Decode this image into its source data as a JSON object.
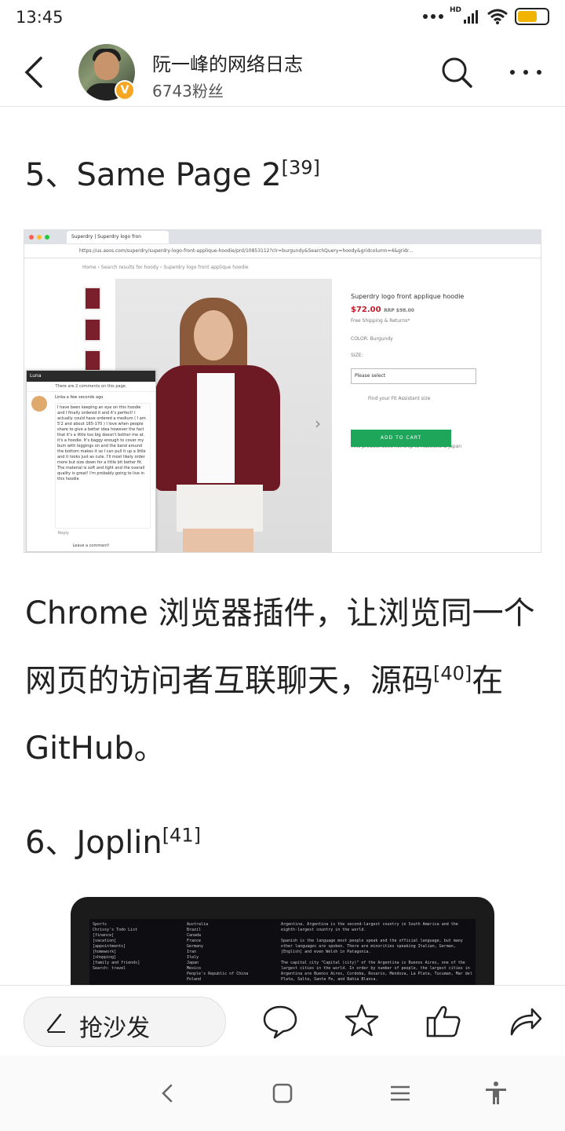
{
  "status": {
    "time": "13:45",
    "network": "HD"
  },
  "header": {
    "author": "阮一峰的网络日志",
    "fans": "6743粉丝",
    "verified_badge": "V"
  },
  "article": {
    "item5_prefix": "5、Same Page 2",
    "item5_ref": "[39]",
    "paragraph_a": "Chrome 浏览器插件，让浏览同一个网页的访问者互联聊天，源码",
    "paragraph_ref": "[40]",
    "paragraph_b": "在 GitHub。",
    "item6_prefix": "6、Joplin",
    "item6_ref": "[41]"
  },
  "screenshot1": {
    "tab_title": "Superdry | Superdry logo fron",
    "url": "https://us.asos.com/superdry/superdry-logo-front-applique-hoodie/prd/10853112?clr=burgundy&SearchQuery=hoody&gridcolumn=4&gridr...",
    "breadcrumb": "Home  ›  Search results for hoody  ›  Superdry logo front applique hoodie",
    "product_title": "Superdry logo front applique hoodie",
    "price": "$72.00",
    "rrp": "RRP $98.00",
    "shipping": "Free Shipping & Returns*",
    "colour": "COLOR: Burgundy",
    "size_label": "SIZE:",
    "size_select": "Please select",
    "fit": "Find your Fit Assistant size",
    "add_to_cart": "ADD TO CART",
    "ship_note": "This product does not ship to Australia & Japan",
    "chat_user": "Luna",
    "chat_sub": "There are 2 comments on this page.",
    "chat_author": "Linka  a few seconds ago",
    "chat_text": "I have been keeping an eye on this hoodie and I finally ordered it and it's perfect! I actually could have ordered a medium ( I am 5'2 and about 165-170 ) I love when people share to give a better idea however the fact that it's a little too big doesn't bother me at. it's a hoodie. It's baggy enough to cover my bum with leggings on and the band around the bottom makes it so I can pull it up a little and it looks just as cute. I'll most likely order more but size down for a little bit better fit. The material is soft and light and the overall quality is great! I'm probably going to live in this hoodie",
    "chat_reply": "Reply",
    "chat_leave": "Leave a comment!"
  },
  "screenshot2": {
    "col1": "Sports\nChrissy's Todo List\n[finance]\n[vacation]\n[appointments]\n[homework]\n[shopping]\n[family and friends]\nSearch: travel",
    "col2": "Australia\nBrazil\nCanada\nFrance\nGermany\nIran\nItaly\nJapan\nMexico\nPeople's Republic of China\nPoland",
    "col3": "Argentina. Argentina is the second-largest country in South America and the eighth-largest country in the world.\n\nSpanish is the language most people speak and the official language, but many other languages are spoken. There are minorities speaking Italian, German, [English] and even Welsh in Patagonia.\n\nThe capital city \"Capital (city)\" of the Argentina is Buenos Aires, one of the largest cities in the world. In order by number of people, the largest cities in Argentina are Buenos Aires, Cordoba, Rosario, Mendoza, La Plata, Tucuman, Mar del Plata, Salta, Santa Fe, and Bahia Blanca."
  },
  "actions": {
    "sofa": "抢沙发"
  },
  "colors": {
    "accent": "#f5a623",
    "cart": "#1ea65a",
    "price": "#c21d2a"
  }
}
